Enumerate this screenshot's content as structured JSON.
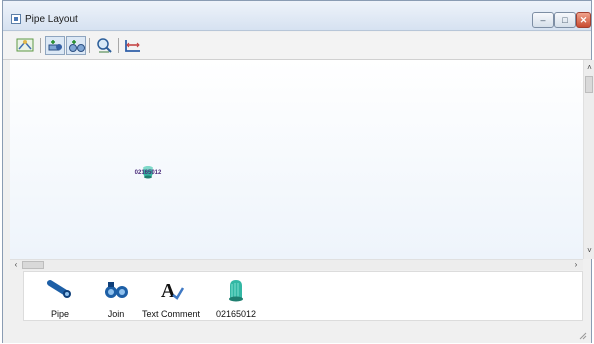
{
  "window": {
    "title": "Pipe Layout"
  },
  "titlebar_buttons": {
    "minimize": "–",
    "maximize": "□",
    "close": "✕"
  },
  "toolbar": {
    "tools": [
      {
        "name": "fit-view-icon"
      },
      {
        "name": "add-pipe-icon"
      },
      {
        "name": "add-join-icon"
      },
      {
        "name": "zoom-icon"
      },
      {
        "name": "measure-icon"
      }
    ]
  },
  "canvas": {
    "component": {
      "label": "02165012",
      "icon": "valve-component-icon"
    }
  },
  "scrollbars": {
    "up": "˄",
    "down": "˅",
    "left": "‹",
    "right": "›"
  },
  "palette": {
    "items": [
      {
        "label": "Pipe",
        "icon": "pipe-icon"
      },
      {
        "label": "Join",
        "icon": "join-icon"
      },
      {
        "label": "Text Comment",
        "icon": "text-comment-icon"
      },
      {
        "label": "02165012",
        "icon": "component-02165012-icon"
      }
    ]
  }
}
